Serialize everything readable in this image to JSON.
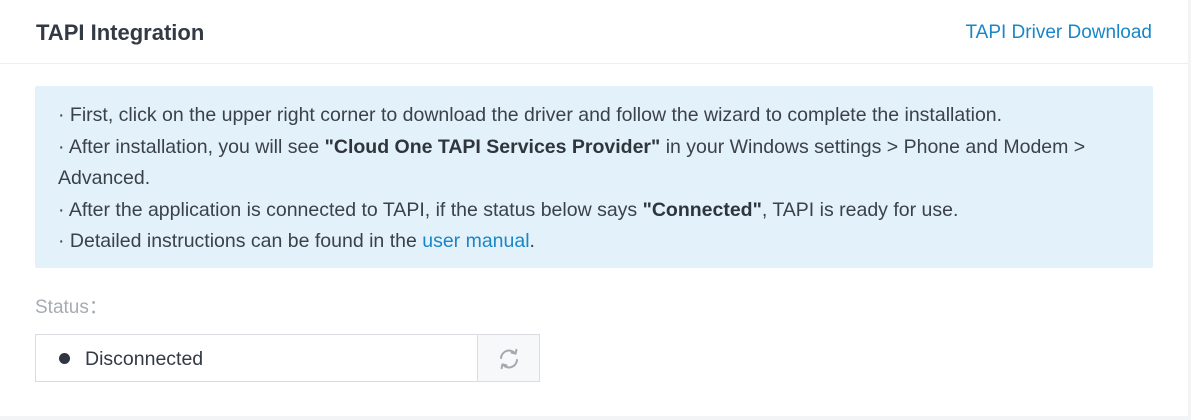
{
  "header": {
    "title": "TAPI Integration",
    "driver_link": "TAPI Driver Download"
  },
  "info": {
    "line1": "· First, click on the upper right corner to download the driver and follow the wizard to complete the installation.",
    "line2_pre": "· After installation, you will see ",
    "line2_bold": "\"Cloud One TAPI Services Provider\"",
    "line2_post": " in your Windows settings > Phone and Modem > Advanced.",
    "line3_pre": "· After the application is connected to TAPI, if the status below says ",
    "line3_bold": "\"Connected\"",
    "line3_post": ", TAPI is ready for use.",
    "line4_pre": "· Detailed instructions can be found in the ",
    "line4_link": "user manual",
    "line4_post": "."
  },
  "status": {
    "label": "Status：",
    "value": "Disconnected",
    "dot_color": "#2f3640",
    "refresh_icon": "refresh-icon"
  },
  "colors": {
    "accent": "#1a86c8",
    "info_background": "#e3f1fb"
  }
}
